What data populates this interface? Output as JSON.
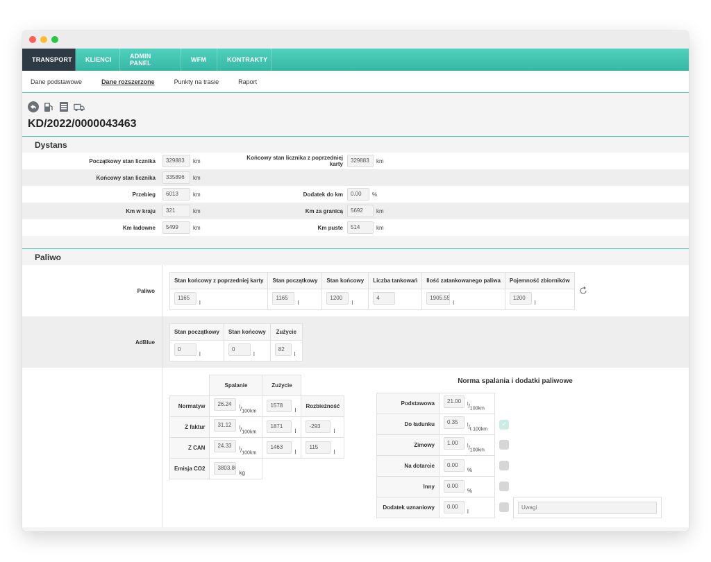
{
  "colors": {
    "accent": "#40c4b0",
    "nav_active": "#2e3b45",
    "dot_red": "#ff5f57",
    "dot_yellow": "#febc2e",
    "dot_green": "#28c840"
  },
  "nav": {
    "tabs": [
      "TRANSPORT",
      "KLIENCI",
      "ADMIN PANEL",
      "WFM",
      "KONTRAKTY"
    ],
    "active": "TRANSPORT"
  },
  "subnav": {
    "items": [
      "Dane podstawowe",
      "Dane rozszerzone",
      "Punkty na trasie",
      "Raport"
    ],
    "active": "Dane rozszerzone"
  },
  "toolbar_icons": [
    "back-icon",
    "fuel-pump-icon",
    "document-icon",
    "truck-icon"
  ],
  "doc_number": "KD/2022/0000043463",
  "dystans": {
    "title": "Dystans",
    "start_label": "Początkowy stan licznika",
    "start_value": "329883",
    "start_unit": "km",
    "prev_end_label": "Końcowy stan licznika z poprzedniej karty",
    "prev_end_value": "329883",
    "prev_end_unit": "km",
    "end_label": "Końcowy stan licznika",
    "end_value": "335896",
    "end_unit": "km",
    "mileage_label": "Przebieg",
    "mileage_value": "6013",
    "mileage_unit": "km",
    "extra_label": "Dodatek do km",
    "extra_value": "0.00",
    "extra_unit": "%",
    "domestic_label": "Km w kraju",
    "domestic_value": "321",
    "domestic_unit": "km",
    "abroad_label": "Km za granicą",
    "abroad_value": "5692",
    "abroad_unit": "km",
    "loaded_label": "Km ładowne",
    "loaded_value": "5499",
    "loaded_unit": "km",
    "empty_label": "Km puste",
    "empty_value": "514",
    "empty_unit": "km"
  },
  "paliwo": {
    "title": "Paliwo",
    "fuel_label": "Paliwo",
    "fuel_headers": [
      "Stan końcowy z poprzedniej karty",
      "Stan początkowy",
      "Stan końcowy",
      "Liczba tankowań",
      "Ilość zatankowanego paliwa",
      "Pojemność zbiorników"
    ],
    "fuel_values": [
      "1165",
      "1165",
      "1200",
      "4",
      "1905.55",
      "1200"
    ],
    "fuel_units": [
      "l",
      "l",
      "l",
      "",
      "l",
      "l"
    ],
    "adblue_label": "AdBlue",
    "adblue_headers": [
      "Stan początkowy",
      "Stan końcowy",
      "Zużycie"
    ],
    "adblue_values": [
      "0",
      "0",
      "82"
    ],
    "adblue_units": [
      "l",
      "l",
      "l"
    ]
  },
  "spalanie": {
    "col_spalanie": "Spalanie",
    "col_zuzycie": "Zużycie",
    "normatyw_label": "Normatyw",
    "normatyw_spalanie": "26.24",
    "normatyw_zuzycie": "1578",
    "roznica_header": "Rozbieżność",
    "faktur_label": "Z faktur",
    "faktur_spalanie": "31.12",
    "faktur_zuzycie": "1871",
    "faktur_roznica": "-293",
    "can_label": "Z CAN",
    "can_spalanie": "24.33",
    "can_zuzycie": "1463",
    "can_roznica": "115",
    "co2_label": "Emisja CO2",
    "co2_value": "3803.80",
    "co2_unit": "kg",
    "unit_l": "l",
    "unit_num": "l",
    "unit_den": "100km"
  },
  "norma": {
    "title": "Norma spalania i dodatki paliwowe",
    "rows": [
      {
        "label": "Podstawowa",
        "value": "21.00",
        "unit_num": "l",
        "unit_den": "100km",
        "check": "none"
      },
      {
        "label": "Do ładunku",
        "value": "0.35",
        "unit_num": "l",
        "unit_den": "t·100km",
        "check": "on"
      },
      {
        "label": "Zimowy",
        "value": "1.00",
        "unit_num": "l",
        "unit_den": "100km",
        "check": "off"
      },
      {
        "label": "Na dotarcie",
        "value": "0.00",
        "unit": "%",
        "check": "off"
      },
      {
        "label": "Inny",
        "value": "0.00",
        "unit": "%",
        "check": "off"
      },
      {
        "label": "Dodatek uznaniowy",
        "value": "0.00",
        "unit": "l",
        "check": "off"
      }
    ],
    "uwagi_placeholder": "Uwagi"
  }
}
